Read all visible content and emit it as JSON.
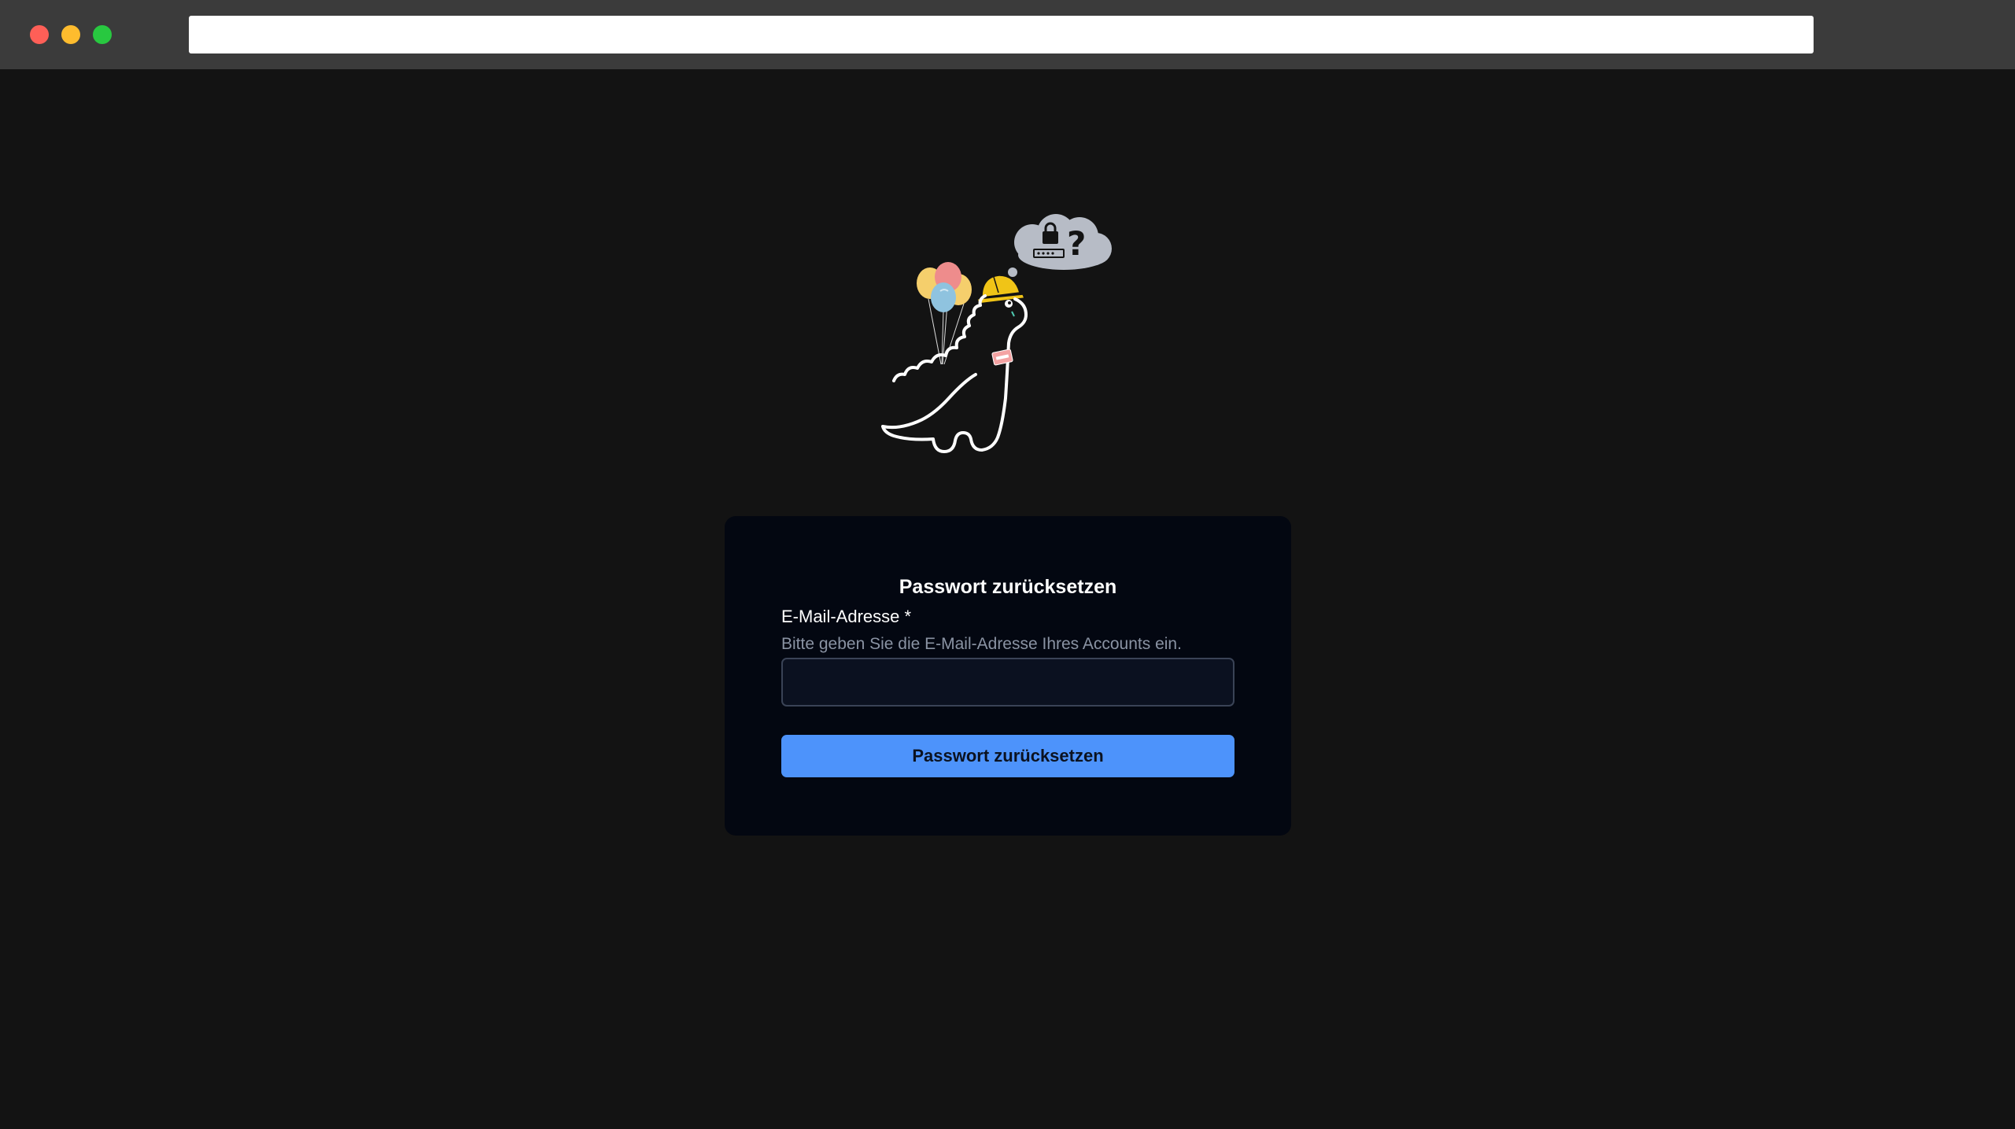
{
  "window": {
    "controls": [
      "close",
      "minimize",
      "maximize"
    ],
    "control_colors": {
      "close": "#fe5f57",
      "minimize": "#febc2e",
      "maximize": "#28c840"
    }
  },
  "address_bar": {
    "value": ""
  },
  "illustration": {
    "name": "dinosaur-with-balloons-thinking-about-password"
  },
  "reset_form": {
    "title": "Passwort zurücksetzen",
    "email_label": "E-Mail-Adresse *",
    "email_help": "Bitte geben Sie die E-Mail-Adresse Ihres Accounts ein.",
    "email_value": "",
    "submit_label": "Passwort zurücksetzen"
  },
  "colors": {
    "page_background": "#131313",
    "card_background": "#030711",
    "accent": "#4d93fb"
  }
}
